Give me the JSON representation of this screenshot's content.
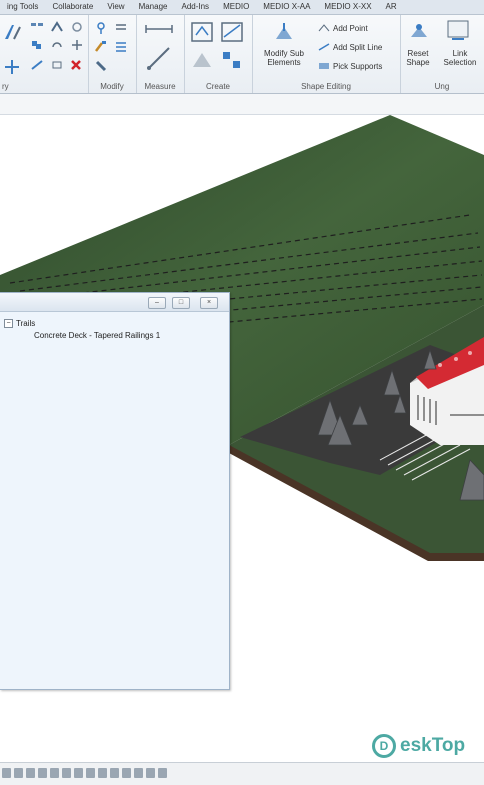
{
  "ribbon": {
    "tabs": [
      "ing Tools",
      "Collaborate",
      "View",
      "Manage",
      "Add-Ins",
      "MEDIO",
      "MEDIO X-AA",
      "MEDIO X-XX",
      "AR"
    ],
    "groups": {
      "geometry": "ry",
      "modify": "Modify",
      "measure": "Measure",
      "create": "Create",
      "shape_editing": "Shape Editing",
      "ung": "Ung"
    },
    "buttons": {
      "modify_sub_elements": "Modify Sub Elements",
      "add_point": "Add Point",
      "add_split_line": "Add Split Line",
      "pick_supports": "Pick Supports",
      "reset_shape": "Reset Shape",
      "link_selection": "Link Selection"
    }
  },
  "browser": {
    "root": "Trails",
    "child": "Concrete Deck - Tapered Railings 1"
  },
  "watermark": {
    "logo_glyph": "D",
    "text": "eskTop"
  },
  "colors": {
    "terrain": "#3d5a36",
    "roof": "#d42a33",
    "accent": "#2e9b94"
  }
}
